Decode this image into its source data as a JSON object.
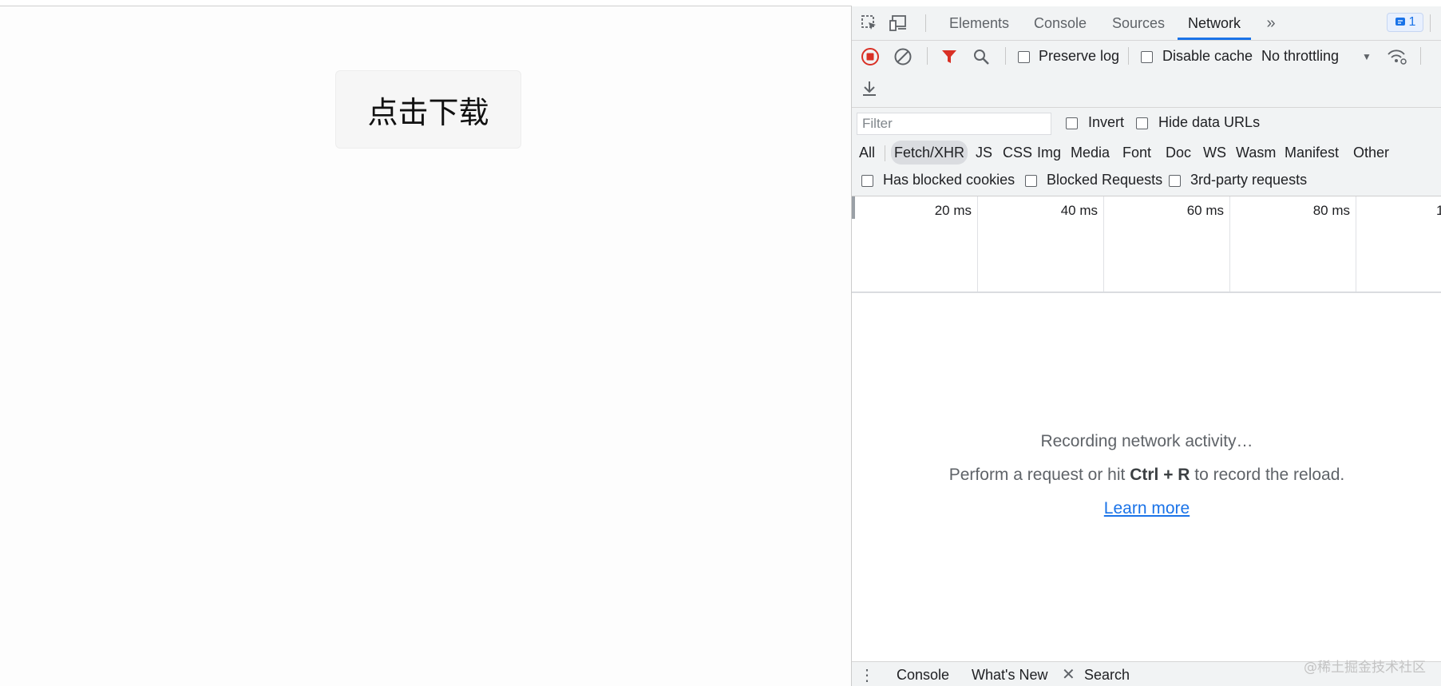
{
  "page": {
    "download_button": "点击下载"
  },
  "devtools": {
    "tabs": [
      "Elements",
      "Console",
      "Sources",
      "Network"
    ],
    "active_tab": "Network",
    "issues_count": "1",
    "toolbar": {
      "preserve_log": "Preserve log",
      "disable_cache": "Disable cache",
      "throttling": "No throttling"
    },
    "filter": {
      "placeholder": "Filter",
      "invert": "Invert",
      "hide_data_urls": "Hide data URLs",
      "types": [
        "All",
        "Fetch/XHR",
        "JS",
        "CSS",
        "Img",
        "Media",
        "Font",
        "Doc",
        "WS",
        "Wasm",
        "Manifest",
        "Other"
      ],
      "selected_type": "Fetch/XHR",
      "has_blocked_cookies": "Has blocked cookies",
      "blocked_requests": "Blocked Requests",
      "third_party": "3rd-party requests"
    },
    "timeline": {
      "ticks": [
        "20 ms",
        "40 ms",
        "60 ms",
        "80 ms",
        "1"
      ]
    },
    "empty_state": {
      "line1": "Recording network activity…",
      "line2_prefix": "Perform a request or hit ",
      "line2_key": "Ctrl + R",
      "line2_suffix": " to record the reload.",
      "learn_more": "Learn more"
    },
    "drawer": {
      "console": "Console",
      "whats_new": "What's New",
      "search": "Search"
    },
    "colors": {
      "accent": "#1a73e8",
      "record": "#d93025",
      "filter_active": "#d93025"
    }
  },
  "watermark": "@稀土掘金技术社区"
}
